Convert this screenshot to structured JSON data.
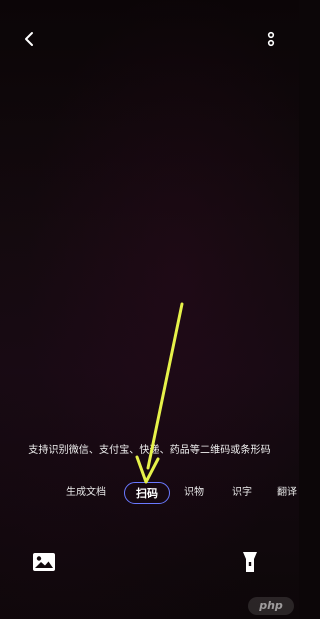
{
  "header": {
    "back_icon": "chevron-left-icon",
    "more_icon": "vertical-dots-icon"
  },
  "hint": {
    "text": "支持识别微信、支付宝、快递、药品等二维码或条形码"
  },
  "modes": {
    "items": [
      {
        "label": "生成文档"
      },
      {
        "label": "扫码",
        "selected": true
      },
      {
        "label": "识物"
      },
      {
        "label": "识字"
      },
      {
        "label": "翻译"
      }
    ]
  },
  "footer": {
    "gallery_icon": "image-gallery-icon",
    "flash_icon": "flashlight-icon"
  },
  "annotation": {
    "arrow_color": "#e6f24a"
  },
  "watermark": {
    "text": "php"
  },
  "colors": {
    "accent": "#6a79ff",
    "background": "#0c0608"
  }
}
